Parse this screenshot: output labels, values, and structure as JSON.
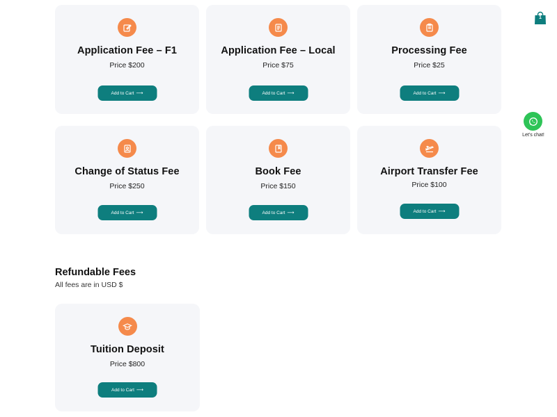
{
  "fees": [
    {
      "title": "Application Fee – F1",
      "price_label": "Price",
      "price": "$200",
      "button": "Add to Cart",
      "icon": "edit-icon"
    },
    {
      "title": "Application Fee – Local",
      "price_label": "Price",
      "price": "$75",
      "button": "Add to Cart",
      "icon": "document-icon"
    },
    {
      "title": "Processing Fee",
      "price_label": "Price",
      "price": "$25",
      "button": "Add to Cart",
      "icon": "clipboard-icon"
    },
    {
      "title": "Change of Status Fee",
      "price_label": "Price",
      "price": "$250",
      "button": "Add to Cart",
      "icon": "id-card-icon"
    },
    {
      "title": "Book Fee",
      "price_label": "Price",
      "price": "$150",
      "button": "Add to Cart",
      "icon": "book-icon"
    },
    {
      "title": "Airport Transfer Fee",
      "price_label": "Price",
      "price": "$100",
      "button": "Add to Cart",
      "icon": "airplane-icon"
    }
  ],
  "refundable": {
    "title": "Refundable Fees",
    "subtitle": "All fees are in USD $",
    "items": [
      {
        "title": "Tuition Deposit",
        "price_label": "Price",
        "price": "$800",
        "button": "Add to Cart",
        "icon": "graduation-cap-icon"
      }
    ]
  },
  "cart": {
    "count": "1"
  },
  "chat": {
    "label": "Let's chat!"
  },
  "colors": {
    "accent_orange": "#f58a4b",
    "button_teal": "#0e7e7e",
    "card_bg": "#f5f6f9",
    "chat_green": "#2ec457"
  }
}
